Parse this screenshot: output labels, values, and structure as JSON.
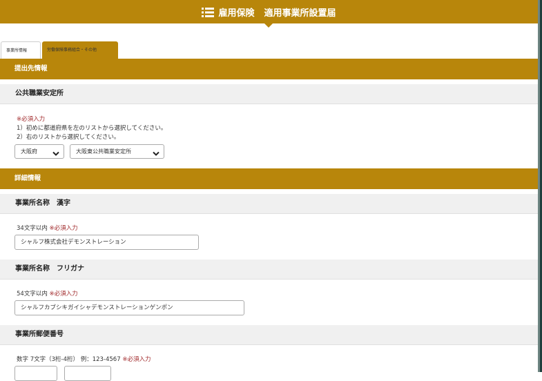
{
  "header": {
    "title_main": "雇用保険",
    "title_sub": "適用事業所設置届"
  },
  "tabs": [
    {
      "label": "事業所情報",
      "active": true
    },
    {
      "label": "労働保険事務組合・その他",
      "active": false
    }
  ],
  "sections": {
    "submission": {
      "title": "提出先情報",
      "office": {
        "title": "公共職業安定所",
        "required": "※必須入力",
        "instruction_1": "1）初めに都道府県を左のリストから選択してください。",
        "instruction_2": "2）右のリストから選択してください。",
        "prefecture_value": "大阪府",
        "office_value": "大阪東公共職業安定所"
      }
    },
    "details": {
      "title": "詳細情報",
      "name_kanji": {
        "title": "事業所名称　漢字",
        "hint": "34文字以内",
        "required": "※必須入力",
        "value": "シャルフ株式会社デモンストレーション"
      },
      "name_kana": {
        "title": "事業所名称　フリガナ",
        "hint": "54文字以内",
        "required": "※必須入力",
        "value": "シャルフカブシキガイシャデモンストレーションゲンポン"
      },
      "postal": {
        "title": "事業所郵便番号",
        "hint": "数字 7文字（3桁-4桁） 例：123-4567",
        "required": "※必須入力"
      }
    }
  },
  "colors": {
    "accent": "#b8860b",
    "required": "#a0282a",
    "sub_bar": "#f0f0f0"
  }
}
